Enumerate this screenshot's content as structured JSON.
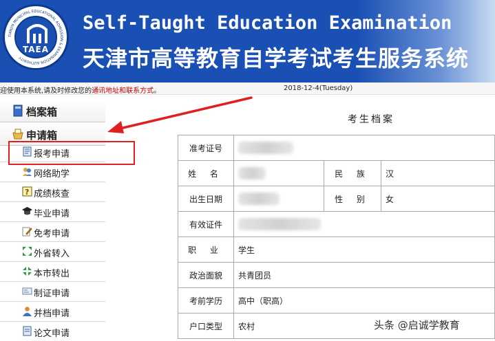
{
  "banner": {
    "logo_text": "TAEA",
    "logo_ring_text": "TIANJIN MUNICIPAL EDUCATIONAL ADMISSION & EXAMINATION AUTHORITY",
    "title_en": "Self-Taught Education Examination",
    "title_cn": "天津市高等教育自学考试考生服务系统"
  },
  "notice": {
    "prefix": "迎使用本系统,请及时修改您的",
    "link": "通讯地址和联系方式",
    "suffix": "。",
    "date": "2018-12-4(Tuesday)"
  },
  "sidebar": {
    "headers": [
      "档案箱",
      "申请箱"
    ],
    "items": [
      {
        "label": "报考申请",
        "icon": "form-icon"
      },
      {
        "label": "网络助学",
        "icon": "users-icon"
      },
      {
        "label": "成绩核查",
        "icon": "question-icon"
      },
      {
        "label": "毕业申请",
        "icon": "graduation-cap-icon"
      },
      {
        "label": "免考申请",
        "icon": "pencil-icon"
      },
      {
        "label": "外省转入",
        "icon": "transfer-in-icon"
      },
      {
        "label": "本市转出",
        "icon": "transfer-out-icon"
      },
      {
        "label": "制证申请",
        "icon": "card-icon"
      },
      {
        "label": "并档申请",
        "icon": "user-icon"
      },
      {
        "label": "论文申请",
        "icon": "document-icon"
      }
    ],
    "highlighted_item": "报考申请"
  },
  "content": {
    "title": "考生档案",
    "rows": {
      "ticket": {
        "label": "准考证号"
      },
      "name": {
        "label": "姓 名",
        "label2": "民 族",
        "value2": "汉"
      },
      "birth": {
        "label": "出生日期",
        "label2": "性 别",
        "value2": "女"
      },
      "id": {
        "label": "有效证件"
      },
      "job": {
        "label": "职 业",
        "value": "学生"
      },
      "politics": {
        "label": "政治面貌",
        "value": "共青团员"
      },
      "edu": {
        "label": "考前学历",
        "value": "高中（职高）"
      },
      "hukou": {
        "label": "户口类型",
        "value": "农村"
      }
    }
  },
  "watermark": "头条 @启诚学教育",
  "colors": {
    "banner_blue": "#1a4fb4",
    "highlight_red": "#e02020",
    "link_red": "#c00000"
  }
}
